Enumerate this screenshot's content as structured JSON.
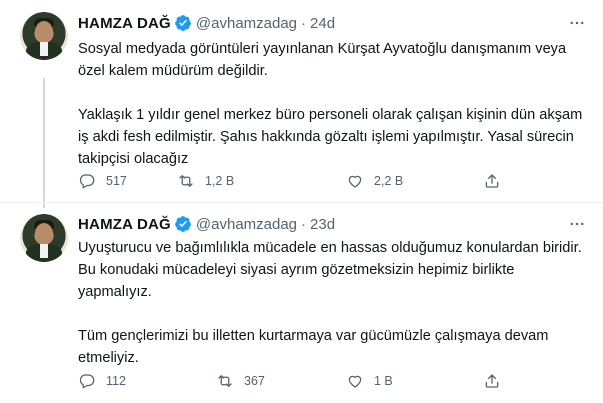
{
  "colors": {
    "text": "#0f1419",
    "secondary": "#536471",
    "verified": "#1d9bf0",
    "divider": "#eff3f4"
  },
  "tweets": [
    {
      "author_name": "HAMZA DAĞ",
      "handle": "@avhamzadag",
      "separator": "·",
      "time": "24d",
      "more_icon": "ellipsis-icon",
      "paragraphs": [
        "Sosyal medyada görüntüleri yayınlanan Kürşat Ayvatoğlu danışmanım veya özel kalem müdürüm değildir.",
        "Yaklaşık 1 yıldır genel merkez büro personeli olarak çalışan kişinin dün akşam iş akdi fesh edilmiştir. Şahıs hakkında gözaltı işlemi yapılmıştır. Yasal sürecin takipçisi olacağız"
      ],
      "replies": "517",
      "retweets": "1,2 B",
      "likes": "2,2 B"
    },
    {
      "author_name": "HAMZA DAĞ",
      "handle": "@avhamzadag",
      "separator": "·",
      "time": "23d",
      "more_icon": "ellipsis-icon",
      "paragraphs": [
        "Uyuşturucu ve bağımlılıkla mücadele en hassas olduğumuz konulardan biridir. Bu konudaki mücadeleyi siyasi ayrım gözetmeksizin hepimiz birlikte yapmalıyız.",
        "Tüm gençlerimizi bu illetten kurtarmaya var gücümüzle çalışmaya devam etmeliyiz."
      ],
      "replies": "112",
      "retweets": "367",
      "likes": "1 B"
    }
  ]
}
